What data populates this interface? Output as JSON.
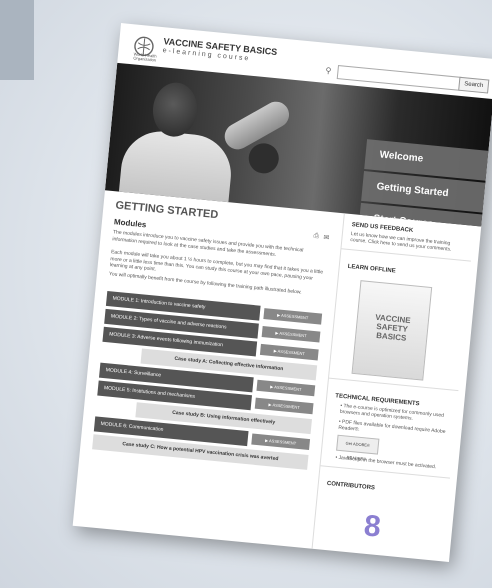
{
  "header": {
    "logo_sub": "World Health Organization",
    "title": "VACCINE SAFETY BASICS",
    "subtitle": "e-learning course",
    "search_placeholder": "",
    "search_button": "Search"
  },
  "menu": [
    "Welcome",
    "Getting Started",
    "Start Course"
  ],
  "main": {
    "title": "GETTING STARTED",
    "section": "Modules",
    "para1": "The modules introduce you to vaccine safety issues and provide you with the technical information required to look at the case studies and take the assessments.",
    "para2": "Each module will take you about 1 ½ hours to complete, but you may find that it takes you a little more or a little less time than this. You can study this course at your own pace, pausing your learning at any point.",
    "para3": "You will optimally benefit from the course by following the training path illustrated below.",
    "assessment_label": "▶ ASSESSMENT",
    "path": [
      {
        "kind": "module",
        "label": "MODULE 1: Introduction to vaccine safety"
      },
      {
        "kind": "module",
        "label": "MODULE 2: Types of vaccine and adverse reactions"
      },
      {
        "kind": "module",
        "label": "MODULE 3: Adverse events following immunization"
      },
      {
        "kind": "case",
        "label": "Case study A: Collecting effective information"
      },
      {
        "kind": "module",
        "label": "MODULE 4: Surveillance"
      },
      {
        "kind": "module",
        "label": "MODULE 5: Institutions and mechanisms"
      },
      {
        "kind": "case",
        "label": "Case study B: Using information effectively"
      },
      {
        "kind": "module",
        "label": "MODULE 6: Communication"
      },
      {
        "kind": "casefull",
        "label": "Case study C: How a potential HPV vaccination crisis was averted"
      }
    ]
  },
  "sidebar": {
    "feedback_title": "SEND US FEEDBACK",
    "feedback_text": "Let us know how we can improve the training course. Click here to send us your comments.",
    "offline_title": "LEARN OFFLINE",
    "book_title": "VACCINE SAFETY BASICS",
    "tech_title": "TECHNICAL REQUIREMENTS",
    "req1": "• The e-course is optimized for commonly used browsers and operation systems.",
    "req2": "• PDF files available for download require Adobe Reader®.",
    "badge": "Get ADOBE® READER®",
    "req3": "• JavaScript in the browser must be activated.",
    "contributors_title": "CONTRIBUTORS"
  },
  "page_number": "8",
  "colors": {
    "menu": "#6e6e6e",
    "module": "#555555",
    "accent": "#8b7fd1"
  }
}
